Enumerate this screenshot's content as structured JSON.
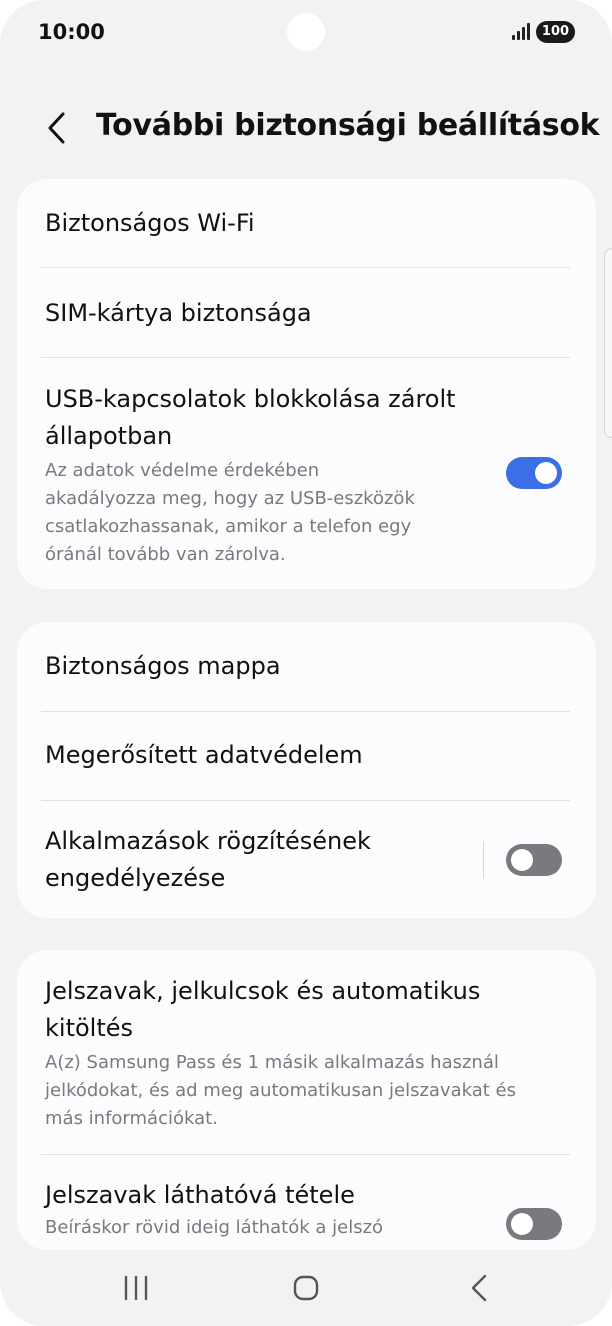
{
  "status": {
    "time": "10:00",
    "battery": "100"
  },
  "header": {
    "title": "További biztonsági beállítások"
  },
  "cards": [
    {
      "items": [
        {
          "title": "Biztonságos Wi-Fi"
        },
        {
          "title": "SIM-kártya biztonsága"
        },
        {
          "title_line1": "USB-kapcsolatok blokkolása zárolt",
          "title_line2": "állapotban",
          "sub": [
            "Az adatok védelme érdekében",
            "akadályozza meg, hogy az USB-eszközök",
            "csatlakozhassanak, amikor a telefon egy",
            "óránál tovább van zárolva."
          ],
          "toggle": "on"
        }
      ]
    },
    {
      "items": [
        {
          "title": "Biztonságos mappa"
        },
        {
          "title": "Megerősített adatvédelem"
        },
        {
          "title_line1": "Alkalmazások rögzítésének",
          "title_line2": "engedélyezése",
          "toggle": "off"
        }
      ]
    },
    {
      "items": [
        {
          "title_line1": "Jelszavak, jelkulcsok és automatikus",
          "title_line2": "kitöltés",
          "sub": [
            "A(z) Samsung Pass és 1 másik alkalmazás használ",
            "jelkódokat, és ad meg automatikusan jelszavakat és",
            "más információkat."
          ]
        },
        {
          "title": "Jelszavak láthatóvá tétele",
          "sub": [
            "Beíráskor rövid ideig láthatók a jelszó"
          ],
          "toggle": "off"
        }
      ]
    }
  ],
  "icons": {
    "back": "chevron-left-icon",
    "recents": "recents-icon",
    "home": "home-icon",
    "nav_back": "nav-back-icon"
  },
  "colors": {
    "accent": "#3b6fe6",
    "background": "#f2f2f4",
    "card": "#fcfcfe"
  }
}
